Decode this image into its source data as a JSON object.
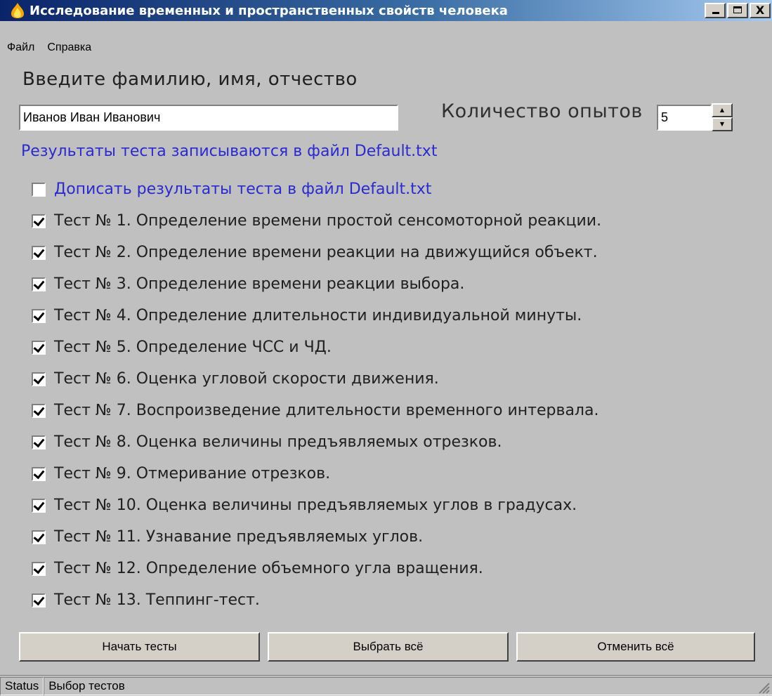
{
  "window": {
    "title": "Исследование временных и пространственных свойств человека",
    "close_glyph": "X"
  },
  "menu": [
    "Файл",
    "Справка"
  ],
  "name_prompt": "Введите фамилию, имя, отчество",
  "name_value": "Иванов Иван Иванович",
  "count_label": "Количество опытов",
  "count_value": "5",
  "info_text": "Результаты теста записываются в файл Default.txt",
  "options": [
    {
      "label": "Дописать результаты теста в файл  Default.txt",
      "checked": false,
      "color": "#2a2ad0"
    },
    {
      "label": "Тест № 1. Определение времени простой сенсомоторной реакции.",
      "checked": true
    },
    {
      "label": "Тест № 2. Определение времени реакции на движущийся объект.",
      "checked": true
    },
    {
      "label": "Тест № 3. Определение времени реакции выбора.",
      "checked": true
    },
    {
      "label": "Тест № 4. Определение длительности индивидуальной минуты.",
      "checked": true
    },
    {
      "label": "Тест № 5. Определение ЧСС и ЧД.",
      "checked": true
    },
    {
      "label": "Тест № 6. Оценка угловой скорости движения.",
      "checked": true
    },
    {
      "label": "Тест № 7. Воспроизведение длительности временного интервала.",
      "checked": true
    },
    {
      "label": "Тест № 8. Оценка величины предъявляемых отрезков.",
      "checked": true
    },
    {
      "label": "Тест № 9. Отмеривание отрезков.",
      "checked": true
    },
    {
      "label": "Тест № 10. Оценка величины предъявляемых углов в градусах.",
      "checked": true
    },
    {
      "label": "Тест № 11. Узнавание предъявляемых углов.",
      "checked": true
    },
    {
      "label": "Тест № 12. Определение объемного угла вращения.",
      "checked": true
    },
    {
      "label": "Тест № 13. Теппинг-тест.",
      "checked": true
    }
  ],
  "buttons": {
    "start": "Начать тесты",
    "select_all": "Выбрать всё",
    "cancel_all": "Отменить всё"
  },
  "status": {
    "label": "Status",
    "value": "Выбор тестов"
  },
  "colors": {
    "background": "#c0c0c0",
    "link_blue": "#2a2ad0",
    "title_gradient_start": "#0a246a"
  }
}
